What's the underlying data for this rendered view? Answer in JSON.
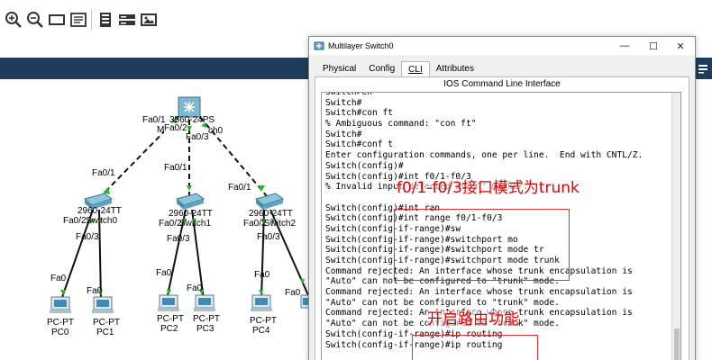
{
  "toolbar": {
    "icons": [
      "zoom-in-icon",
      "zoom-out-icon",
      "rectangle-icon",
      "note-icon",
      "device-palette-icon",
      "router-icon",
      "image-icon"
    ]
  },
  "topology": {
    "multilayer_switch": {
      "model": "3560-24PS",
      "name": "Multilayer Switch0",
      "ports": [
        "Fa0/1",
        "Fa0/2",
        "Fa0/3"
      ]
    },
    "labels": {
      "ms_fa01": "Fa0/1",
      "ms_model": "3560-24PS",
      "ms_fa02": "Fa0/2",
      "ms_fa03": "Fa0/3",
      "ms_name_prefix": "M",
      "ms_name_suffix": "ch0",
      "sw0_fa01": "Fa0/1",
      "sw0_model": "2960-24TT",
      "sw0_fa02": "Fa0/2",
      "sw0_name": "Switch0",
      "sw0_fa03": "Fa0/3",
      "sw1_fa01": "Fa0/1",
      "sw1_model": "2960-24TT",
      "sw1_fa02": "Fa0/2",
      "sw1_name": "Switch1",
      "sw1_fa03": "Fa0/3",
      "sw2_fa01": "Fa0/1",
      "sw2_model": "2960-24TT",
      "sw2_fa02": "Fa0/2",
      "sw2_name": "Switch2",
      "sw2_fa03": "Fa0/3",
      "pc0_fa0": "Fa0",
      "pc1_fa0": "Fa0",
      "pc2_fa0": "Fa0",
      "pc3_fa0": "Fa0",
      "pc4_fa0": "Fa0",
      "pc5_fa0": "Fa0"
    },
    "pcs": [
      {
        "type": "PC-PT",
        "name": "PC0"
      },
      {
        "type": "PC-PT",
        "name": "PC1"
      },
      {
        "type": "PC-PT",
        "name": "PC2"
      },
      {
        "type": "PC-PT",
        "name": "PC3"
      },
      {
        "type": "PC-PT",
        "name": "PC4"
      }
    ]
  },
  "window": {
    "title": "Multilayer Switch0",
    "controls": {
      "minimize": "—",
      "maximize": "☐",
      "close": "✕"
    },
    "tabs": [
      "Physical",
      "Config",
      "CLI",
      "Attributes"
    ],
    "active_tab": "CLI",
    "panel_title": "IOS Command Line Interface",
    "console_lines": [
      "Switch>en",
      "Switch#",
      "Switch#con ft",
      "% Ambiguous command: \"con ft\"",
      "Switch#",
      "Switch#conf t",
      "Enter configuration commands, one per line.  End with CNTL/Z.",
      "Switch(config)#",
      "Switch(config)#int f0/1-f0/3",
      "% Invalid input detected at '^' marker.",
      "",
      "Switch(config)#int ran",
      "Switch(config)#int range f0/1-f0/3",
      "Switch(config-if-range)#sw",
      "Switch(config-if-range)#switchport mo",
      "Switch(config-if-range)#switchport mode tr",
      "Switch(config-if-range)#switchport mode trunk",
      "Command rejected: An interface whose trunk encapsulation is",
      "\"Auto\" can not be configured to \"trunk\" mode.",
      "Command rejected: An interface whose trunk encapsulation is",
      "\"Auto\" can not be configured to \"trunk\" mode.",
      "Command rejected: An interface whose trunk encapsulation is",
      "\"Auto\" can not be configured to \"trunk\" mode.",
      "Switch(config-if-range)#ip routing",
      "Switch(config-if-range)#ip routing"
    ]
  },
  "annotations": {
    "trunk_note": "f0/1-f0/3接口模式为trunk",
    "routing_note": "开启路由功能"
  },
  "colors": {
    "band": "#1e3c5c",
    "annotation": "#e00000",
    "link_up": "#2fb12f"
  }
}
